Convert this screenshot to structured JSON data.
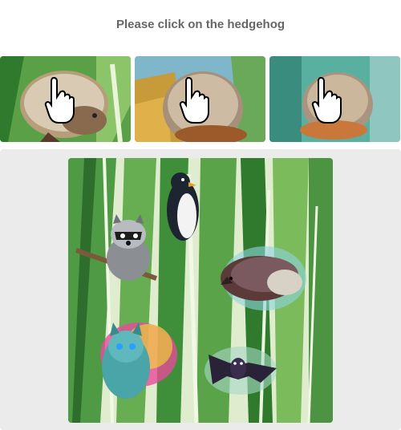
{
  "captcha": {
    "prompt": "Please click on the hedgehog",
    "example_images": [
      {
        "subject": "hedgehog",
        "cursor_icon": "hand-pointer-icon"
      },
      {
        "subject": "hedgehog",
        "cursor_icon": "hand-pointer-icon"
      },
      {
        "subject": "hedgehog",
        "cursor_icon": "hand-pointer-icon"
      }
    ],
    "challenge_image": {
      "background": "watercolor-leaves",
      "animals": [
        "penguin",
        "raccoon",
        "hedgehog",
        "cat",
        "bat"
      ]
    },
    "colors": {
      "prompt_text": "#666666",
      "panel_bg": "#ebebeb",
      "leaf_green": "#3f8f3a"
    }
  }
}
